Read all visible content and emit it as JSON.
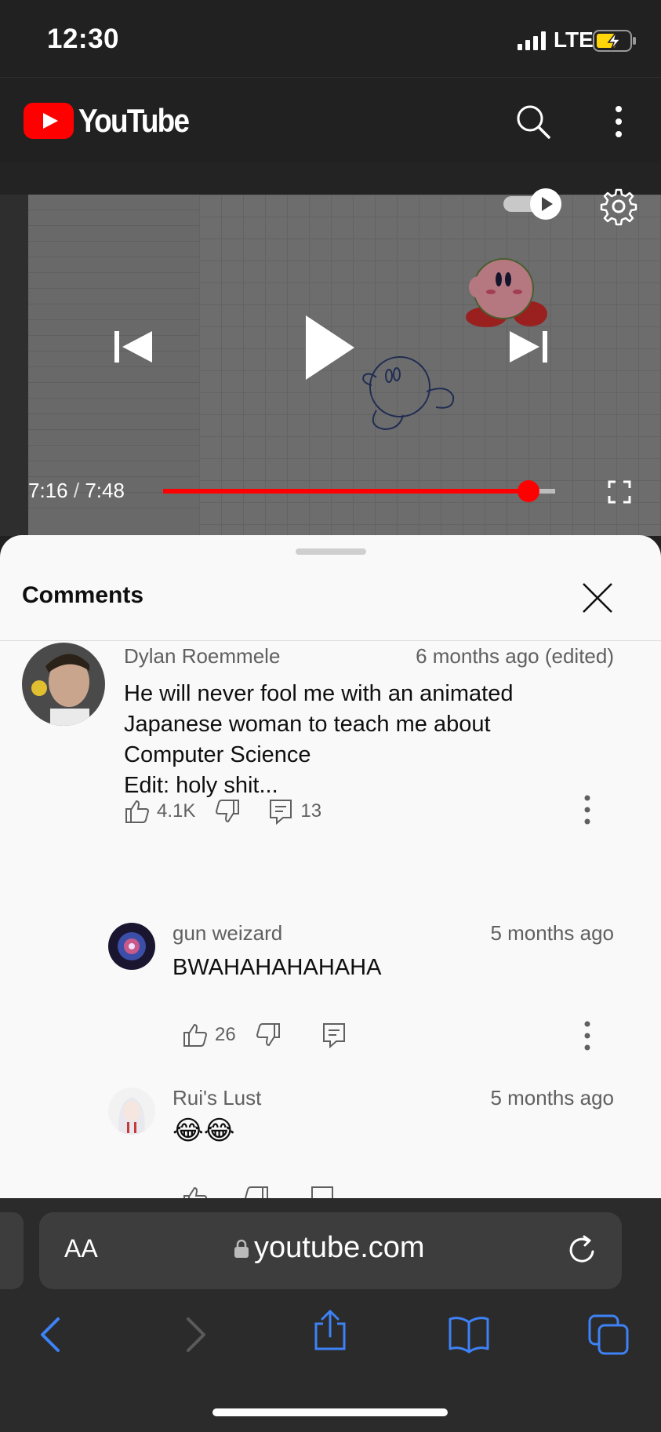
{
  "status_bar": {
    "time": "12:30",
    "network": "LTE",
    "battery_state": "charging"
  },
  "header": {
    "logo_text": "YouTube",
    "brand_color": "#ff0000"
  },
  "player": {
    "current_time": "7:16",
    "separator": "/",
    "duration": "7:48",
    "progress_fraction": 0.9317,
    "autoplay_on": true,
    "controls": [
      "previous-icon",
      "play-icon",
      "next-icon",
      "gear-icon",
      "fullscreen-icon"
    ]
  },
  "comments_panel": {
    "title": "Comments",
    "comments": [
      {
        "author": "Dylan Roemmele",
        "time": "6 months ago (edited)",
        "text": "He will never fool me with an animated\nJapanese woman to teach me about\nComputer Science\nEdit: holy shit...",
        "likes": "4.1K",
        "replies": "13"
      },
      {
        "author": "gun weizard",
        "time": "5 months ago",
        "text": "BWAHAHAHAHAHA",
        "likes": "26",
        "replies": ""
      },
      {
        "author": "Rui's Lust",
        "time": "5 months ago",
        "text": "😂😂",
        "likes": "",
        "replies": ""
      }
    ]
  },
  "browser": {
    "text_size_label": "AA",
    "url": "youtube.com",
    "accent_color": "#3d82f6"
  }
}
